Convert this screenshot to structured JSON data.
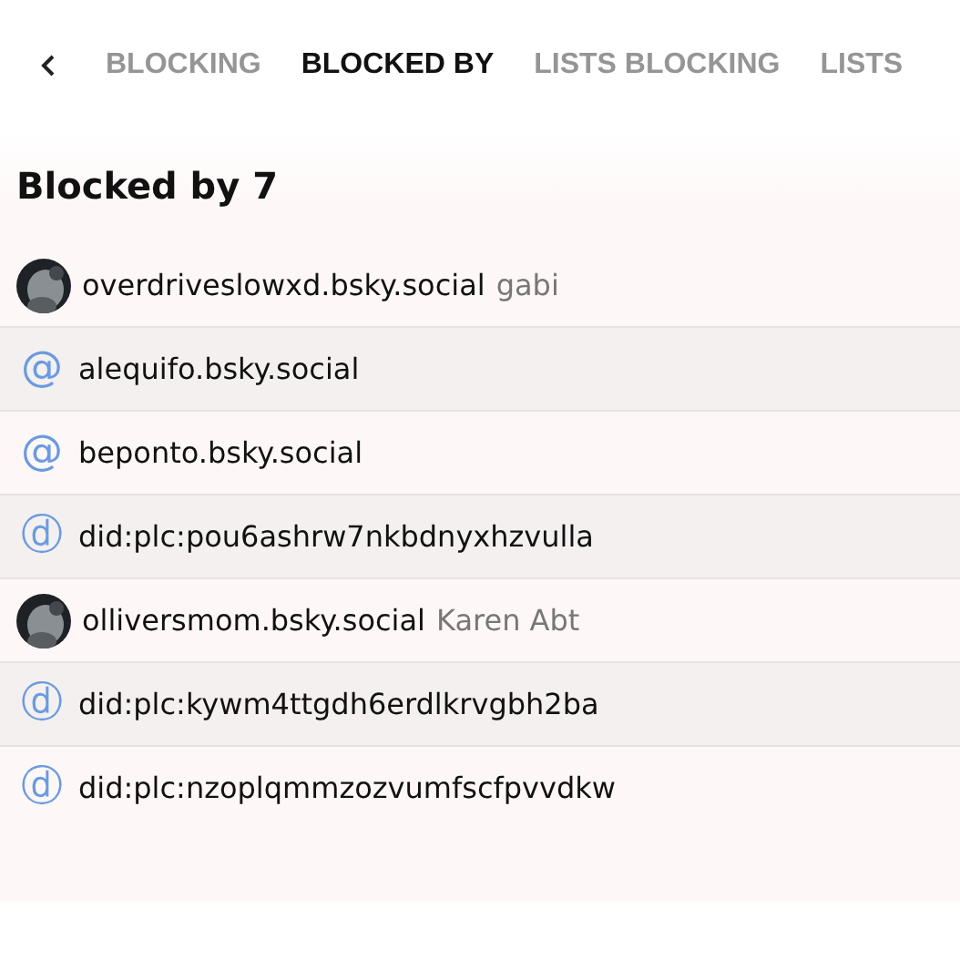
{
  "tabs": [
    {
      "label": "BLOCKING",
      "selected": false
    },
    {
      "label": "BLOCKED BY",
      "selected": true
    },
    {
      "label": "LISTS BLOCKING",
      "selected": false
    },
    {
      "label": "LISTS",
      "selected": false
    }
  ],
  "heading": "Blocked by 7",
  "accounts": [
    {
      "kind": "avatar",
      "handle": "overdriveslowxd.bsky.social",
      "display_name": "gabi"
    },
    {
      "kind": "glyph",
      "icon": "@",
      "handle": "alequifo.bsky.social"
    },
    {
      "kind": "glyph",
      "icon": "@",
      "handle": "beponto.bsky.social"
    },
    {
      "kind": "glyph",
      "icon": "ⓓ",
      "handle": "did:plc:pou6ashrw7nkbdnyxhzvulla"
    },
    {
      "kind": "avatar",
      "handle": "olliversmom.bsky.social",
      "display_name": "Karen Abt"
    },
    {
      "kind": "glyph",
      "icon": "ⓓ",
      "handle": "did:plc:kywm4ttgdh6erdlkrvgbh2ba"
    },
    {
      "kind": "glyph",
      "icon": "ⓓ",
      "handle": "did:plc:nzoplqmmzozvumfscfpvvdkw"
    }
  ]
}
